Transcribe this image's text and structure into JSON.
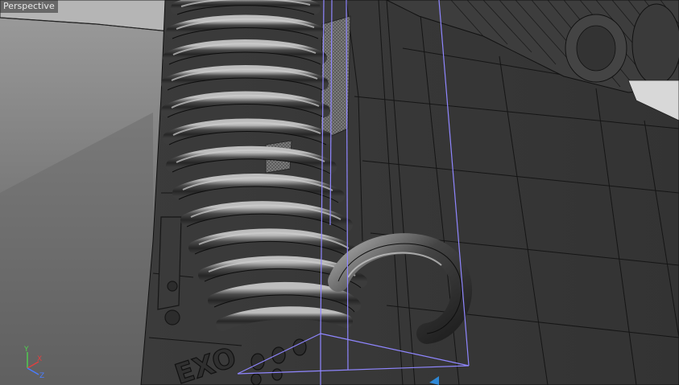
{
  "viewport": {
    "view_name": "Perspective",
    "background_top": "#9a9a9a",
    "background_bottom": "#5a5a5a"
  },
  "axes": {
    "y_label": "Y",
    "x_label": "X",
    "z_label": "Z",
    "y_color": "#4fd14f",
    "x_color": "#e04040",
    "z_color": "#4a7dff"
  },
  "model": {
    "embossed_text": "EXO",
    "bounding_box_color": "#8f86ff",
    "mesh_color": "#3a3a3a",
    "wire_color": "#111111"
  }
}
